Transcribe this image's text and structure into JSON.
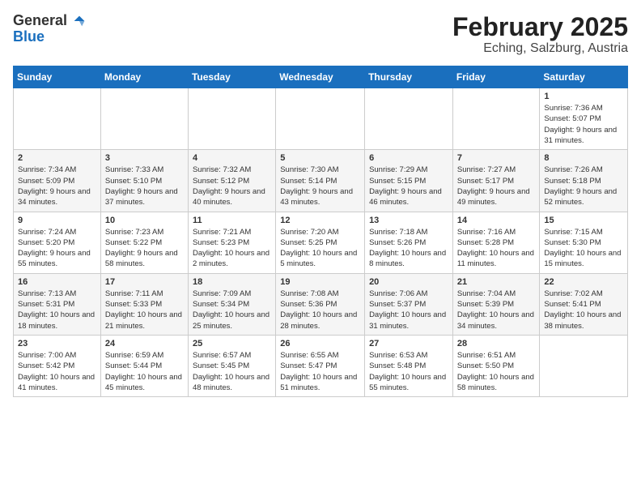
{
  "header": {
    "logo_line1": "General",
    "logo_line2": "Blue",
    "month": "February 2025",
    "location": "Eching, Salzburg, Austria"
  },
  "weekdays": [
    "Sunday",
    "Monday",
    "Tuesday",
    "Wednesday",
    "Thursday",
    "Friday",
    "Saturday"
  ],
  "weeks": [
    [
      {
        "day": "",
        "info": ""
      },
      {
        "day": "",
        "info": ""
      },
      {
        "day": "",
        "info": ""
      },
      {
        "day": "",
        "info": ""
      },
      {
        "day": "",
        "info": ""
      },
      {
        "day": "",
        "info": ""
      },
      {
        "day": "1",
        "info": "Sunrise: 7:36 AM\nSunset: 5:07 PM\nDaylight: 9 hours and 31 minutes."
      }
    ],
    [
      {
        "day": "2",
        "info": "Sunrise: 7:34 AM\nSunset: 5:09 PM\nDaylight: 9 hours and 34 minutes."
      },
      {
        "day": "3",
        "info": "Sunrise: 7:33 AM\nSunset: 5:10 PM\nDaylight: 9 hours and 37 minutes."
      },
      {
        "day": "4",
        "info": "Sunrise: 7:32 AM\nSunset: 5:12 PM\nDaylight: 9 hours and 40 minutes."
      },
      {
        "day": "5",
        "info": "Sunrise: 7:30 AM\nSunset: 5:14 PM\nDaylight: 9 hours and 43 minutes."
      },
      {
        "day": "6",
        "info": "Sunrise: 7:29 AM\nSunset: 5:15 PM\nDaylight: 9 hours and 46 minutes."
      },
      {
        "day": "7",
        "info": "Sunrise: 7:27 AM\nSunset: 5:17 PM\nDaylight: 9 hours and 49 minutes."
      },
      {
        "day": "8",
        "info": "Sunrise: 7:26 AM\nSunset: 5:18 PM\nDaylight: 9 hours and 52 minutes."
      }
    ],
    [
      {
        "day": "9",
        "info": "Sunrise: 7:24 AM\nSunset: 5:20 PM\nDaylight: 9 hours and 55 minutes."
      },
      {
        "day": "10",
        "info": "Sunrise: 7:23 AM\nSunset: 5:22 PM\nDaylight: 9 hours and 58 minutes."
      },
      {
        "day": "11",
        "info": "Sunrise: 7:21 AM\nSunset: 5:23 PM\nDaylight: 10 hours and 2 minutes."
      },
      {
        "day": "12",
        "info": "Sunrise: 7:20 AM\nSunset: 5:25 PM\nDaylight: 10 hours and 5 minutes."
      },
      {
        "day": "13",
        "info": "Sunrise: 7:18 AM\nSunset: 5:26 PM\nDaylight: 10 hours and 8 minutes."
      },
      {
        "day": "14",
        "info": "Sunrise: 7:16 AM\nSunset: 5:28 PM\nDaylight: 10 hours and 11 minutes."
      },
      {
        "day": "15",
        "info": "Sunrise: 7:15 AM\nSunset: 5:30 PM\nDaylight: 10 hours and 15 minutes."
      }
    ],
    [
      {
        "day": "16",
        "info": "Sunrise: 7:13 AM\nSunset: 5:31 PM\nDaylight: 10 hours and 18 minutes."
      },
      {
        "day": "17",
        "info": "Sunrise: 7:11 AM\nSunset: 5:33 PM\nDaylight: 10 hours and 21 minutes."
      },
      {
        "day": "18",
        "info": "Sunrise: 7:09 AM\nSunset: 5:34 PM\nDaylight: 10 hours and 25 minutes."
      },
      {
        "day": "19",
        "info": "Sunrise: 7:08 AM\nSunset: 5:36 PM\nDaylight: 10 hours and 28 minutes."
      },
      {
        "day": "20",
        "info": "Sunrise: 7:06 AM\nSunset: 5:37 PM\nDaylight: 10 hours and 31 minutes."
      },
      {
        "day": "21",
        "info": "Sunrise: 7:04 AM\nSunset: 5:39 PM\nDaylight: 10 hours and 34 minutes."
      },
      {
        "day": "22",
        "info": "Sunrise: 7:02 AM\nSunset: 5:41 PM\nDaylight: 10 hours and 38 minutes."
      }
    ],
    [
      {
        "day": "23",
        "info": "Sunrise: 7:00 AM\nSunset: 5:42 PM\nDaylight: 10 hours and 41 minutes."
      },
      {
        "day": "24",
        "info": "Sunrise: 6:59 AM\nSunset: 5:44 PM\nDaylight: 10 hours and 45 minutes."
      },
      {
        "day": "25",
        "info": "Sunrise: 6:57 AM\nSunset: 5:45 PM\nDaylight: 10 hours and 48 minutes."
      },
      {
        "day": "26",
        "info": "Sunrise: 6:55 AM\nSunset: 5:47 PM\nDaylight: 10 hours and 51 minutes."
      },
      {
        "day": "27",
        "info": "Sunrise: 6:53 AM\nSunset: 5:48 PM\nDaylight: 10 hours and 55 minutes."
      },
      {
        "day": "28",
        "info": "Sunrise: 6:51 AM\nSunset: 5:50 PM\nDaylight: 10 hours and 58 minutes."
      },
      {
        "day": "",
        "info": ""
      }
    ]
  ]
}
